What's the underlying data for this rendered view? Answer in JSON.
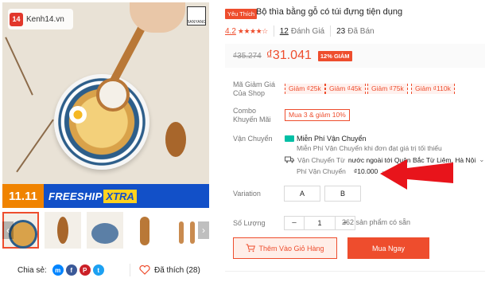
{
  "watermark": {
    "site": "Kenh14.vn",
    "badge": "14"
  },
  "main_image": {
    "alt_brand_lettering": "BANYANG",
    "promo": {
      "date": "11.11",
      "free": "FREESHIP",
      "xtra": "XTRA"
    }
  },
  "thumbnails": {
    "prev": "‹",
    "next": "›",
    "count": 5
  },
  "share": {
    "label": "Chia sẻ:",
    "icons": [
      "messenger-icon",
      "facebook-icon",
      "pinterest-icon",
      "twitter-icon"
    ]
  },
  "liked": {
    "text": "Đã thích (28)"
  },
  "product": {
    "tag": "Yêu Thích",
    "title": "Bộ thìa bằng gỗ có túi đựng tiện dụng",
    "rating": "4.2",
    "stars": 4.2,
    "reviews_count": "12",
    "reviews_label": "Đánh Giá",
    "sold_count": "23",
    "sold_label": "Đã Bán"
  },
  "price": {
    "old": "₫35.274",
    "current": "₫31.041",
    "discount": "12% GIẢM"
  },
  "vouchers": {
    "label": "Mã Giảm Giá Của Shop",
    "items": [
      "Giảm ₫25k",
      "Giảm ₫45k",
      "Giảm ₫75k",
      "Giảm ₫110k"
    ]
  },
  "combo": {
    "label": "Combo Khuyến Mãi",
    "tag": "Mua 3 & giảm 10%"
  },
  "shipping": {
    "label": "Vận Chuyển",
    "free_title": "Miễn Phí Vận Chuyển",
    "free_sub": "Miễn Phí Vận Chuyển khi đơn đạt giá trị tối thiểu",
    "from_label": "Vận Chuyển Từ",
    "from_value": "nước ngoài tới Quận Bắc Từ Liêm, Hà Nội",
    "fee_label": "Phí Vận Chuyển",
    "fee_value": "₫10.000"
  },
  "variation": {
    "label": "Variation",
    "options": [
      "A",
      "B"
    ]
  },
  "quantity": {
    "label": "Số Lượng",
    "minus": "−",
    "value": "1",
    "plus": "+",
    "stock": "262 sản phẩm có sẵn"
  },
  "actions": {
    "add_to_cart": "Thêm Vào Giỏ Hàng",
    "buy_now": "Mua Ngay"
  },
  "colors": {
    "accent": "#ee4d2d",
    "annotation_arrow": "#e8141b",
    "promo_blue": "#1250c8"
  }
}
